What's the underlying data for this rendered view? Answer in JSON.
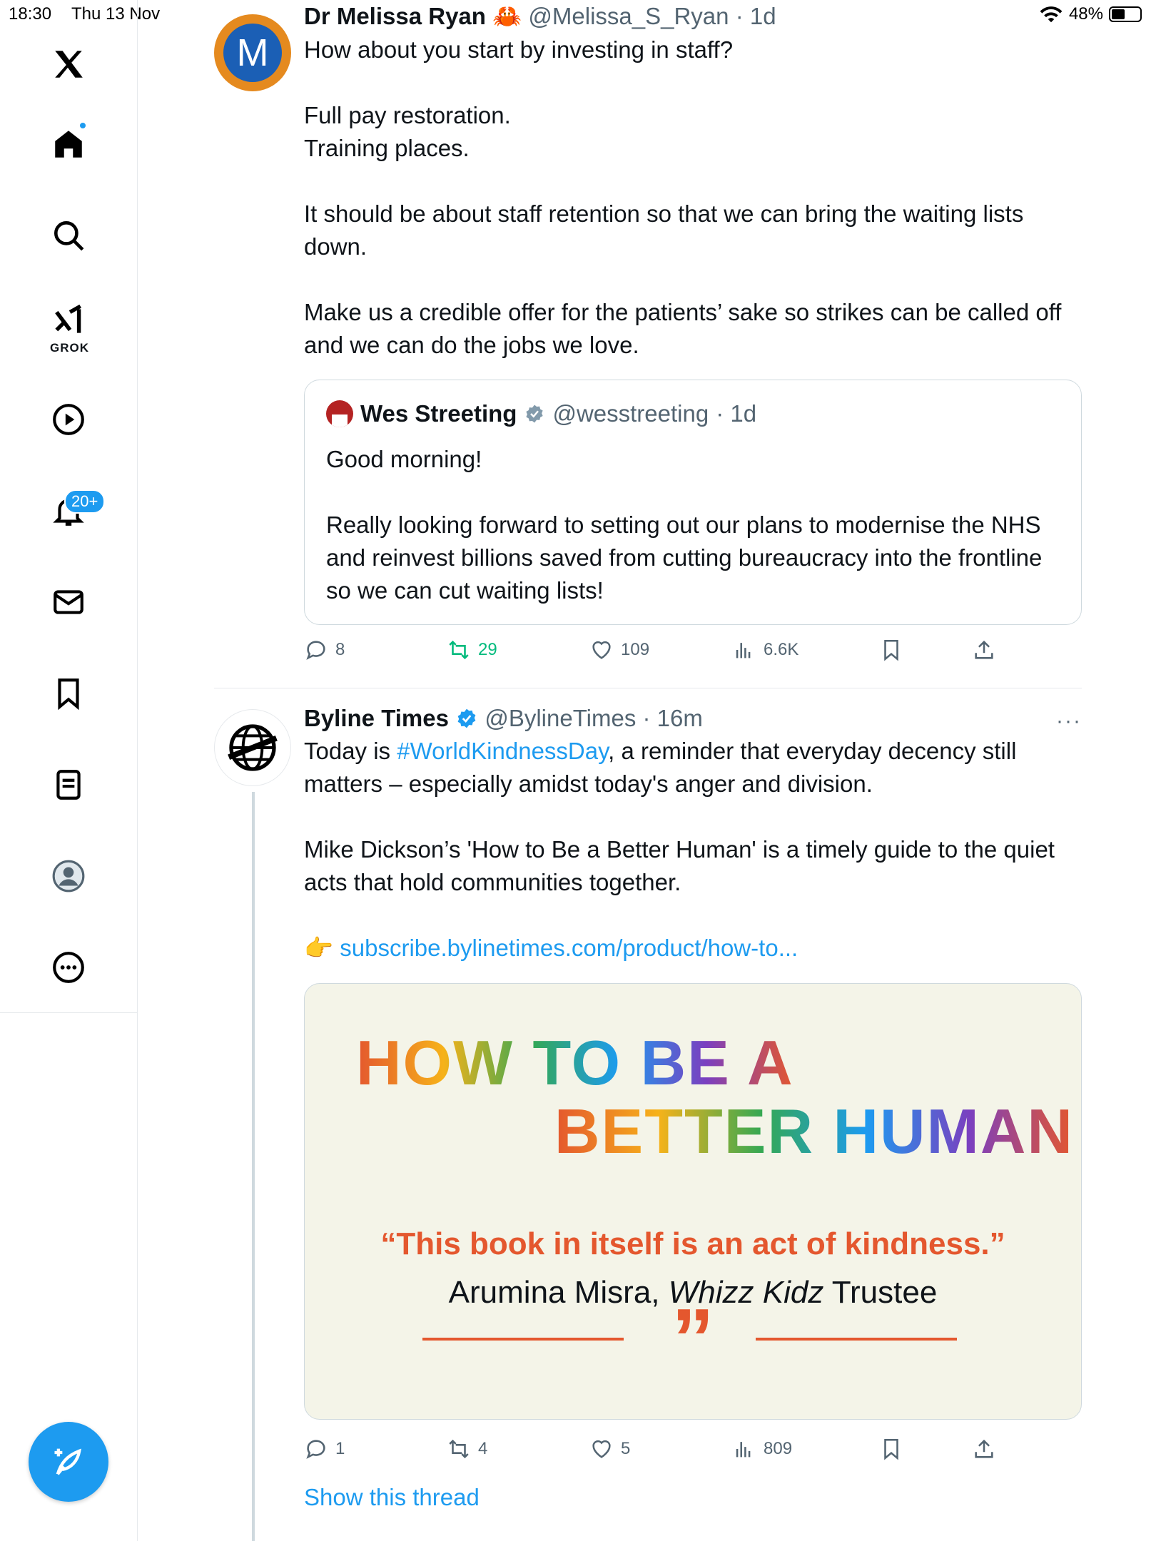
{
  "status_bar": {
    "time": "18:30",
    "date": "Thu 13 Nov",
    "battery": "48%"
  },
  "sidebar": {
    "grok_label": "GROK",
    "notifications_badge": "20+",
    "items": [
      "x-logo",
      "home-icon",
      "search-icon",
      "grok-icon",
      "video-icon",
      "notifications-icon",
      "messages-icon",
      "bookmarks-icon",
      "lists-icon",
      "profile-icon",
      "more-icon"
    ]
  },
  "tweets": [
    {
      "name": "Dr Melissa Ryan",
      "emoji": "🦀",
      "handle": "@Melissa_S_Ryan",
      "time": "· 1d",
      "text": "How about you start by investing in staff?\n\nFull pay restoration.\nTraining places.\n\nIt should be about staff retention so that we can bring the waiting lists down.\n\nMake us a credible offer for the patients’ sake so strikes can be called off and we can do the jobs we love.",
      "quote": {
        "name": "Wes Streeting",
        "handle": "@wesstreeting",
        "time": "· 1d",
        "text": "Good morning!\n\nReally looking forward to setting out our plans to modernise the NHS and reinvest billions saved from cutting bureaucracy into the frontline so we can cut waiting lists!"
      },
      "stats": {
        "replies": "8",
        "reposts": "29",
        "likes": "109",
        "views": "6.6K"
      }
    },
    {
      "name": "Byline Times",
      "handle": "@BylineTimes",
      "time": "· 16m",
      "text_before": "Today is ",
      "hashtag": "#WorldKindnessDay",
      "text_after": ", a reminder that everyday decency still matters – especially amidst today's anger and division.\n\nMike Dickson’s 'How to Be a Better Human' is a timely guide to the quiet acts that hold communities together.\n\n",
      "link_emoji": "👉",
      "link": "subscribe.bylinetimes.com/product/how-to...",
      "media": {
        "title_line1": "HOW TO BE A",
        "title_line2": "BETTER HUMAN",
        "quote": "“This book in itself is an act of kindness.”",
        "attribution_name": "Arumina Misra, ",
        "attribution_org": "Whizz Kidz",
        "attribution_role": " Trustee",
        "closing_marks": "”"
      },
      "stats": {
        "replies": "1",
        "reposts": "4",
        "likes": "5",
        "views": "809"
      },
      "show_thread": "Show this thread",
      "more": "···"
    }
  ],
  "colors": {
    "accent": "#1d9bf0",
    "repost": "#00ba7c",
    "muted": "#536471",
    "quote_red": "#e4572e"
  }
}
